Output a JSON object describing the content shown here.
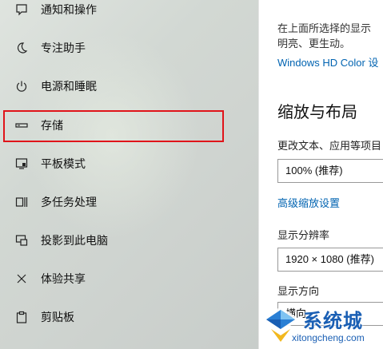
{
  "sidebar": {
    "items": [
      {
        "label": "通知和操作",
        "icon": "notification-icon"
      },
      {
        "label": "专注助手",
        "icon": "moon-icon"
      },
      {
        "label": "电源和睡眠",
        "icon": "power-icon"
      },
      {
        "label": "存储",
        "icon": "storage-icon"
      },
      {
        "label": "平板模式",
        "icon": "tablet-icon"
      },
      {
        "label": "多任务处理",
        "icon": "multitasking-icon"
      },
      {
        "label": "投影到此电脑",
        "icon": "projector-icon"
      },
      {
        "label": "体验共享",
        "icon": "share-icon"
      },
      {
        "label": "剪贴板",
        "icon": "clipboard-icon"
      }
    ],
    "highlighted_item": "存储",
    "highlight_color": "#e0141a"
  },
  "main": {
    "description_line1": "在上面所选择的显示",
    "description_line2": "明亮、更生动。",
    "hdr_link": "Windows HD Color 设",
    "scale_heading": "缩放与布局",
    "scale_label": "更改文本、应用等项目",
    "scale_value": "100% (推荐)",
    "advanced_scaling_link": "高级缩放设置",
    "resolution_label": "显示分辨率",
    "resolution_value": "1920 × 1080 (推荐)",
    "orientation_label": "显示方向",
    "orientation_value": "横向"
  },
  "watermark": {
    "name": "系统城",
    "url": "xitongcheng.com"
  },
  "colors": {
    "link": "#0063b1",
    "sidebar_bg": "#d2d8d3"
  }
}
